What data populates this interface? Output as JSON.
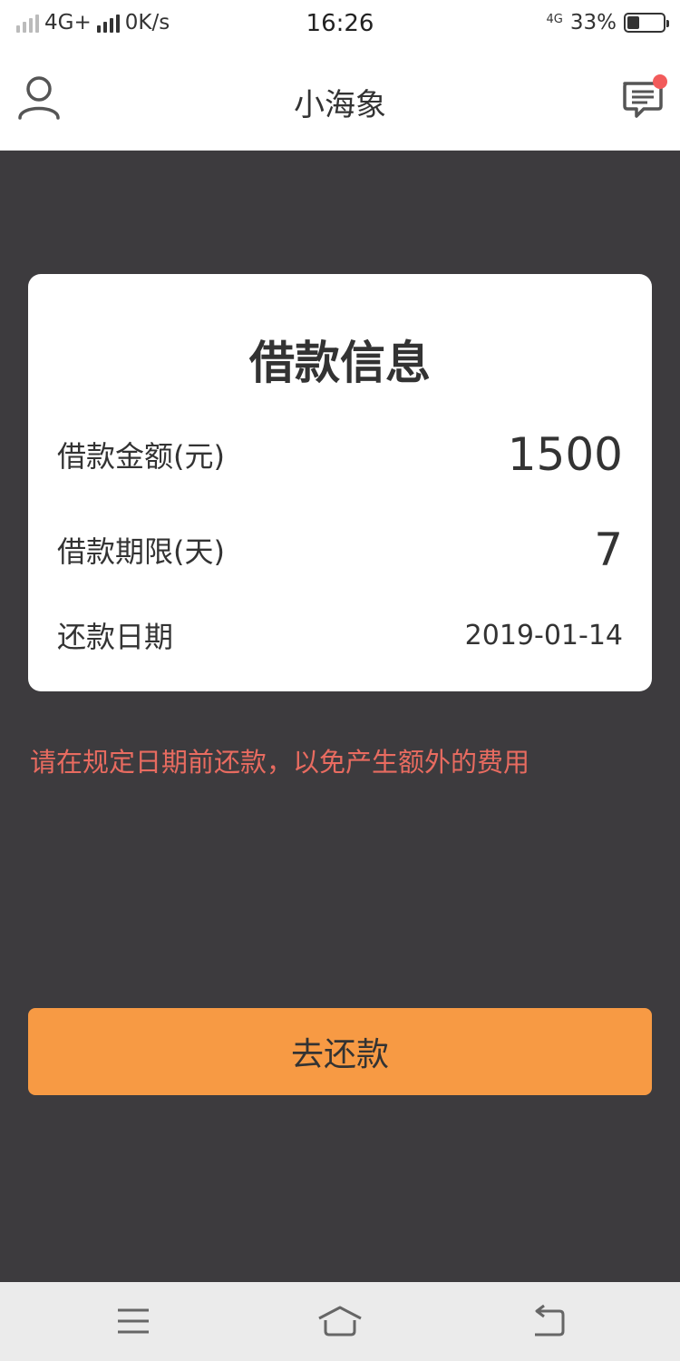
{
  "status_bar": {
    "network_left": "4G+",
    "speed": "0K/s",
    "time": "16:26",
    "network_right": "4G",
    "network_right_sub": "1\n2",
    "battery_percent_label": "33%",
    "battery_level": 0.33
  },
  "header": {
    "title": "小海象",
    "user_icon": "user-icon",
    "message_icon": "message-icon",
    "has_unread": true
  },
  "loan_card": {
    "title": "借款信息",
    "rows": [
      {
        "label": "借款金额(元)",
        "value": "1500"
      },
      {
        "label": "借款期限(天)",
        "value": "7"
      },
      {
        "label": "还款日期",
        "value": "2019-01-14"
      }
    ]
  },
  "notice": "请在规定日期前还款，以免产生额外的费用",
  "repay_button": "去还款",
  "nav": {
    "menu_icon": "menu-icon",
    "home_icon": "home-icon",
    "back_icon": "back-icon"
  },
  "colors": {
    "background": "#3d3b3e",
    "accent": "#f79a44",
    "notice": "#e86b60",
    "badge": "#f25b5b"
  }
}
